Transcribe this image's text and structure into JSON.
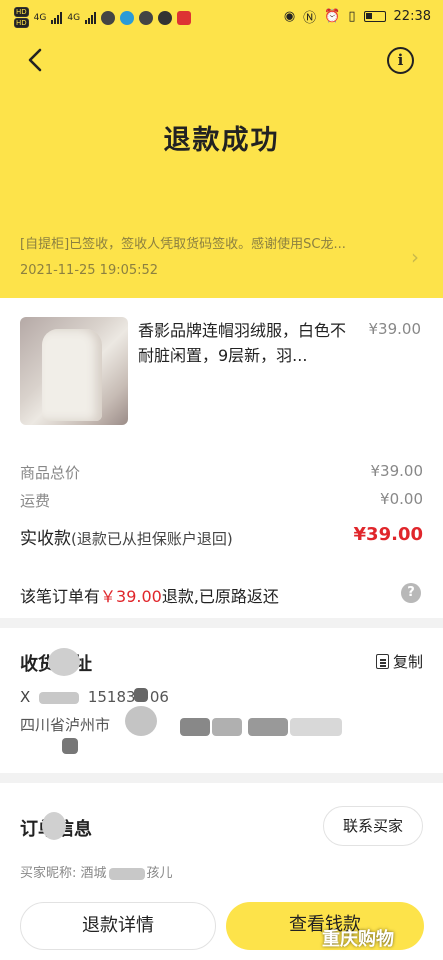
{
  "status_bar": {
    "network_left": "4G",
    "network_right": "4G",
    "time": "22:38"
  },
  "header": {
    "title": "退款成功",
    "back_icon": "chevron-left-icon",
    "info_label": "i"
  },
  "logistics": {
    "message": "[自提柜]已签收，签收人凭取货码签收。感谢使用SC龙...",
    "time": "2021-11-25 19:05:52"
  },
  "product": {
    "name": "香影品牌连帽羽绒服，白色不耐脏闲置，9层新，羽...",
    "price": "¥39.00"
  },
  "summary": {
    "total_label": "商品总价",
    "total_value": "¥39.00",
    "shipping_label": "运费",
    "shipping_value": "¥0.00",
    "paid_label": "实收款",
    "paid_hint": "(退款已从担保账户退回)",
    "paid_value": "¥39.00"
  },
  "refund_note": {
    "prefix": "该笔订单有",
    "amount": "￥39.00",
    "suffix": "退款,已原路返还",
    "help_label": "?"
  },
  "address": {
    "title": "收货地址",
    "copy_label": "复制",
    "phone_partial": "151836 06",
    "line2_prefix": "四川省泸州市"
  },
  "order_info": {
    "title": "订单信息",
    "contact_label": "联系买家",
    "nickname_prefix": "买家昵称: 酒城",
    "nickname_suffix": "孩儿"
  },
  "actions": {
    "refund_detail": "退款详情",
    "view_wallet": "查看钱款"
  },
  "watermark": "重庆购物",
  "colors": {
    "brand_yellow": "#fde34a",
    "price_red": "#e0262b"
  }
}
